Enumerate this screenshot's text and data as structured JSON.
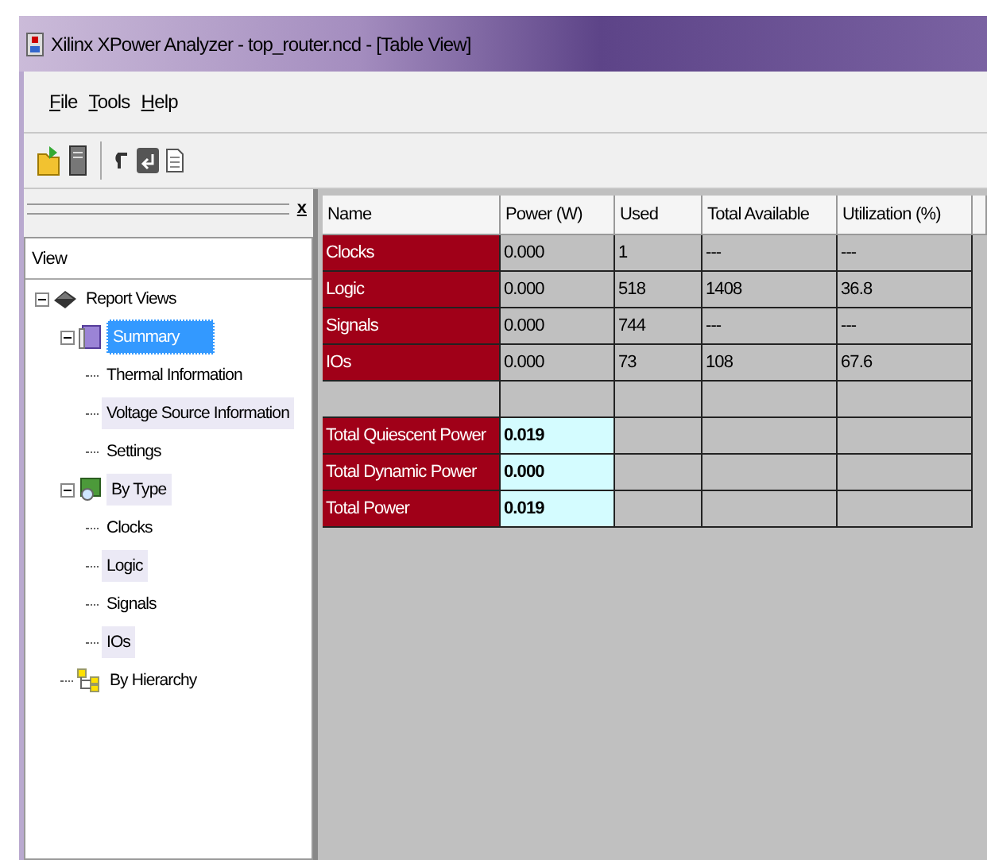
{
  "window": {
    "title": "Xilinx XPower Analyzer - top_router.ncd - [Table View]"
  },
  "menu": [
    "File",
    "Tools",
    "Help"
  ],
  "pane": {
    "close": "x",
    "column": "View"
  },
  "tree": [
    {
      "label": "Report Views",
      "kind": "chip",
      "selected": false,
      "expanded": true,
      "children": [
        {
          "label": "Summary",
          "kind": "book",
          "selected": true,
          "expanded": true,
          "children": [
            {
              "label": "Thermal Information",
              "selected": false
            },
            {
              "label": "Voltage Source Information",
              "selected": false
            },
            {
              "label": "Settings",
              "selected": false
            }
          ]
        },
        {
          "label": "By Type",
          "kind": "type",
          "selected": false,
          "expanded": true,
          "children": [
            {
              "label": "Clocks",
              "selected": false
            },
            {
              "label": "Logic",
              "selected": false
            },
            {
              "label": "Signals",
              "selected": false
            },
            {
              "label": "IOs",
              "selected": false
            }
          ]
        },
        {
          "label": "By Hierarchy",
          "kind": "hier",
          "selected": false
        }
      ]
    }
  ],
  "table": {
    "columns": [
      "Name",
      "Power (W)",
      "Used",
      "Total Available",
      "Utilization (%)"
    ],
    "rows": [
      {
        "kind": "data",
        "cells": [
          "Clocks",
          "0.000",
          "1",
          "---",
          "---"
        ]
      },
      {
        "kind": "data",
        "cells": [
          "Logic",
          "0.000",
          "518",
          "1408",
          "36.8"
        ]
      },
      {
        "kind": "data",
        "cells": [
          "Signals",
          "0.000",
          "744",
          "---",
          "---"
        ]
      },
      {
        "kind": "data",
        "cells": [
          "IOs",
          "0.000",
          "73",
          "108",
          "67.6"
        ]
      },
      {
        "kind": "blank",
        "cells": []
      },
      {
        "kind": "total",
        "cells": [
          "Total Quiescent Power",
          "0.019"
        ]
      },
      {
        "kind": "total",
        "cells": [
          "Total Dynamic Power",
          "0.000"
        ]
      },
      {
        "kind": "total",
        "cells": [
          "Total Power",
          "0.019"
        ]
      }
    ]
  }
}
